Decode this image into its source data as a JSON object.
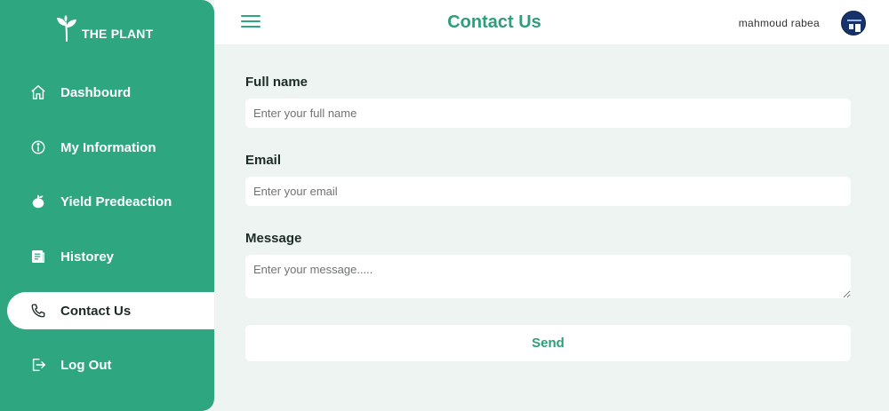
{
  "app": {
    "logo_text": "THE PLANT"
  },
  "sidebar": {
    "items": [
      {
        "label": "Dashbourd",
        "icon": "home-icon",
        "active": false
      },
      {
        "label": "My Information",
        "icon": "info-icon",
        "active": false
      },
      {
        "label": "Yield Predeaction",
        "icon": "yield-icon",
        "active": false
      },
      {
        "label": "Historey",
        "icon": "history-icon",
        "active": false
      },
      {
        "label": "Contact Us",
        "icon": "phone-icon",
        "active": true
      },
      {
        "label": "Log Out",
        "icon": "logout-icon",
        "active": false
      }
    ]
  },
  "header": {
    "title": "Contact Us",
    "username": "mahmoud rabea"
  },
  "form": {
    "full_name": {
      "label": "Full name",
      "placeholder": "Enter your full name",
      "value": ""
    },
    "email": {
      "label": "Email",
      "placeholder": "Enter your email",
      "value": ""
    },
    "message": {
      "label": "Message",
      "placeholder": "Enter your message.....",
      "value": ""
    },
    "send_label": "Send"
  },
  "colors": {
    "accent": "#2ea67f",
    "title": "#2e9e7a",
    "background": "#eef4f1"
  }
}
